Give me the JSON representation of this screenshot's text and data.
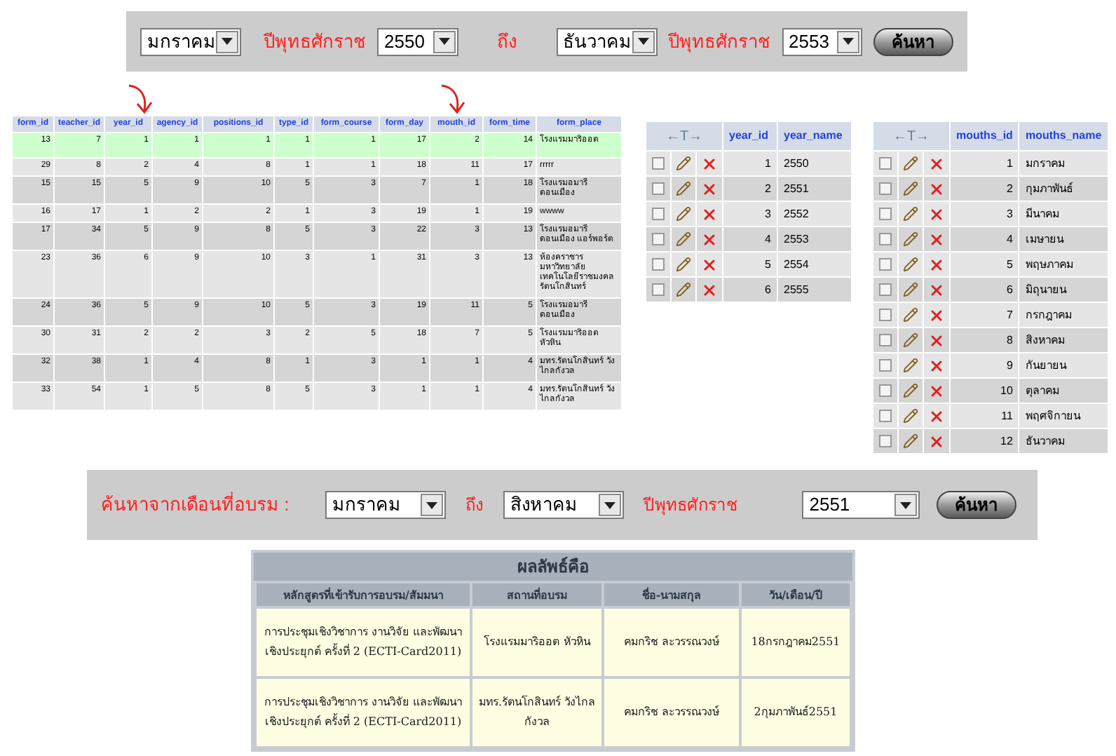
{
  "top_search": {
    "from_month": "มกราคม",
    "year_label_1": "ปีพุทธศักราช",
    "from_year": "2550",
    "to_label": "ถึง",
    "to_month": "ธันวาคม",
    "year_label_2": "ปีพุทธศักราช",
    "to_year": "2553",
    "button": "ค้นหา"
  },
  "forms_table": {
    "columns": [
      "form_id",
      "teacher_id",
      "year_id",
      "agency_id",
      "positions_id",
      "type_id",
      "form_course",
      "form_day",
      "mouth_id",
      "form_time",
      "form_place"
    ],
    "rows": [
      {
        "selected": true,
        "cells": [
          "13",
          "7",
          "1",
          "1",
          "1",
          "1",
          "1",
          "17",
          "2",
          "14",
          "โรงแรมมาริออต"
        ]
      },
      {
        "selected": false,
        "cells": [
          "29",
          "8",
          "2",
          "4",
          "8",
          "1",
          "1",
          "18",
          "11",
          "17",
          "rrrrr"
        ]
      },
      {
        "selected": false,
        "cells": [
          "15",
          "15",
          "5",
          "9",
          "10",
          "5",
          "3",
          "7",
          "1",
          "18",
          "โรงแรมอมารี ดอนเมือง"
        ]
      },
      {
        "selected": false,
        "cells": [
          "16",
          "17",
          "1",
          "2",
          "2",
          "1",
          "3",
          "19",
          "1",
          "19",
          "wwww"
        ]
      },
      {
        "selected": false,
        "cells": [
          "17",
          "34",
          "5",
          "9",
          "8",
          "5",
          "3",
          "22",
          "3",
          "13",
          "โรงแรมอมารี ดอนเมือง แอร์พอร์ต"
        ]
      },
      {
        "selected": false,
        "cells": [
          "23",
          "36",
          "6",
          "9",
          "10",
          "3",
          "1",
          "31",
          "3",
          "13",
          "ห้องคราชาร มหาวิทยาลัย เทคโนโลยีราชมงคล รัตนโกสินทร์"
        ]
      },
      {
        "selected": false,
        "cells": [
          "24",
          "36",
          "5",
          "9",
          "10",
          "5",
          "3",
          "19",
          "11",
          "5",
          "โรงแรมอมารี ดอนเมือง"
        ]
      },
      {
        "selected": false,
        "cells": [
          "30",
          "31",
          "2",
          "2",
          "3",
          "2",
          "5",
          "18",
          "7",
          "5",
          "โรงแรมมาริออต หัวหิน"
        ]
      },
      {
        "selected": false,
        "cells": [
          "32",
          "38",
          "1",
          "4",
          "8",
          "1",
          "3",
          "1",
          "1",
          "4",
          "มทร.รัตนโกสินทร์ วังไกลกังวล"
        ]
      },
      {
        "selected": false,
        "cells": [
          "33",
          "54",
          "1",
          "5",
          "8",
          "5",
          "3",
          "1",
          "1",
          "4",
          "มทร.รัตนโกสินทร์ วังไกลกังวล"
        ]
      }
    ]
  },
  "years_table": {
    "action_header": "←T→",
    "columns": [
      "year_id",
      "year_name"
    ],
    "rows": [
      {
        "checked": false,
        "cells": [
          "1",
          "2550"
        ]
      },
      {
        "checked": false,
        "cells": [
          "2",
          "2551"
        ]
      },
      {
        "checked": false,
        "cells": [
          "3",
          "2552"
        ]
      },
      {
        "checked": false,
        "cells": [
          "4",
          "2553"
        ]
      },
      {
        "checked": false,
        "cells": [
          "5",
          "2554"
        ]
      },
      {
        "checked": false,
        "cells": [
          "6",
          "2555"
        ]
      }
    ]
  },
  "months_table": {
    "action_header": "←T→",
    "columns": [
      "mouths_id",
      "mouths_name"
    ],
    "rows": [
      {
        "checked": false,
        "cells": [
          "1",
          "มกราคม"
        ]
      },
      {
        "checked": false,
        "cells": [
          "2",
          "กุมภาพันธ์"
        ]
      },
      {
        "checked": false,
        "cells": [
          "3",
          "มีนาคม"
        ]
      },
      {
        "checked": false,
        "cells": [
          "4",
          "เมษายน"
        ]
      },
      {
        "checked": false,
        "cells": [
          "5",
          "พฤษภาคม"
        ]
      },
      {
        "checked": false,
        "cells": [
          "6",
          "มิถุนายน"
        ]
      },
      {
        "checked": false,
        "cells": [
          "7",
          "กรกฎาคม"
        ]
      },
      {
        "checked": false,
        "cells": [
          "8",
          "สิงหาคม"
        ]
      },
      {
        "checked": false,
        "cells": [
          "9",
          "กันยายน"
        ]
      },
      {
        "checked": false,
        "cells": [
          "10",
          "ตุลาคม"
        ]
      },
      {
        "checked": false,
        "cells": [
          "11",
          "พฤศจิกายน"
        ]
      },
      {
        "checked": false,
        "cells": [
          "12",
          "ธันวาคม"
        ]
      }
    ]
  },
  "month_search": {
    "label": "ค้นหาจากเดือนที่อบรม :",
    "from_month": "มกราคม",
    "to_label": "ถึง",
    "to_month": "สิงหาคม",
    "year_label": "ปีพุทธศักราช",
    "year": "2551",
    "button": "ค้นหา"
  },
  "results": {
    "title": "ผลลัพธ์คือ",
    "columns": [
      "หลักสูตรที่เข้ารับการอบรม/สัมมนา",
      "สถานที่อบรม",
      "ชื่อ-นามสกุล",
      "วัน/เดือน/ปี"
    ],
    "rows": [
      [
        "การประชุมเชิงวิชาการ งานวิจัย และพัฒนาเชิงประยุกต์ ครั้งที่ 2 (ECTI-Card2011)",
        "โรงแรมมาริออต หัวหิน",
        "คมกริช ละวรรณวงษ์",
        "18กรกฎาคม2551"
      ],
      [
        "การประชุมเชิงวิชาการ งานวิจัย และพัฒนาเชิงประยุกต์ ครั้งที่ 2 (ECTI-Card2011)",
        "มทร.รัตนโกสินทร์ วังไกลกังวล",
        "คมกริช ละวรรณวงษ์",
        "2กุมภาพันธ์2551"
      ]
    ]
  }
}
